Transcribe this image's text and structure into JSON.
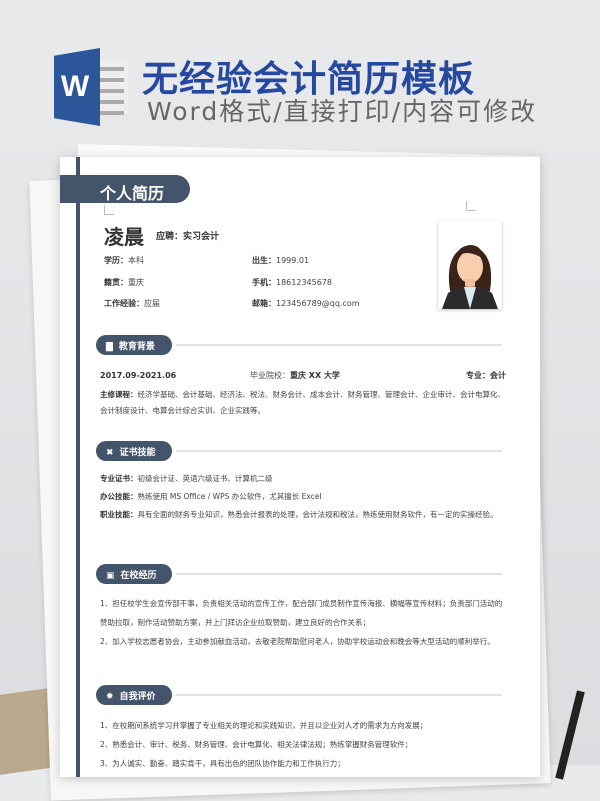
{
  "banner": {
    "logo_letter": "W",
    "title": "无经验会计简历模板",
    "subtitle": "Word格式/直接打印/内容可修改"
  },
  "resume": {
    "header": "个人简历",
    "name": "凌晨",
    "apply_label": "应聘：",
    "apply_value": "实习会计",
    "info": [
      {
        "label": "学历：",
        "value": "本科"
      },
      {
        "label": "出生：",
        "value": "1999.01"
      },
      {
        "label": "籍贯：",
        "value": "重庆"
      },
      {
        "label": "手机：",
        "value": "18612345678"
      },
      {
        "label": "工作经验：",
        "value": "应届"
      },
      {
        "label": "邮箱：",
        "value": "123456789@qq.com"
      }
    ],
    "education": {
      "title": "教育背景",
      "period": "2017.09-2021.06",
      "school_label": "毕业院校：",
      "school": "重庆 XX 大学",
      "major_label": "专业：",
      "major": "会计",
      "courses_label": "主修课程：",
      "courses": "经济学基础、会计基础、经济法、税法、财务会计、成本会计、财务管理、管理会计、企业审计、会计电算化、会计制度设计、电算会计综合实训、企业实践等。"
    },
    "skills": {
      "title": "证书技能",
      "items": [
        {
          "label": "专业证书：",
          "value": "初级会计证、英语六级证书、计算机二级"
        },
        {
          "label": "办公技能：",
          "value": "熟练使用 MS Office / WPS 办公软件，尤其擅长 Excel"
        },
        {
          "label": "职业技能：",
          "value": "具有全面的财务专业知识，熟悉会计报表的处理，会计法规和税法，熟练使用财务软件，有一定的实操经验。"
        }
      ]
    },
    "campus": {
      "title": "在校经历",
      "items": [
        "1、担任校学生会宣传部干事，负责相关活动的宣传工作，配合部门成员制作宣传海报、横幅等宣传材料；负责部门活动的赞助拉取，制作活动赞助方案，并上门拜访企业拉取赞助，建立良好的合作关系；",
        "2、加入学校志愿者协会，主动参加献血活动，去敬老院帮助慰问老人，协助学校运动会和晚会等大型活动的顺利举行。"
      ]
    },
    "self": {
      "title": "自我评价",
      "items": [
        "1、在校期间系统学习并掌握了专业相关的理论和实践知识，并且以企业对人才的需求为方向发展；",
        "2、熟悉会计、审计、税务、财务管理、会计电算化、相关法律法规；熟练掌握财务管理软件；",
        "3、为人诚实、勤奋、踏实肯干，具有出色的团队协作能力和工作执行力；"
      ]
    }
  },
  "colors": {
    "accent": "#44546a",
    "title_blue": "#2548a0"
  }
}
